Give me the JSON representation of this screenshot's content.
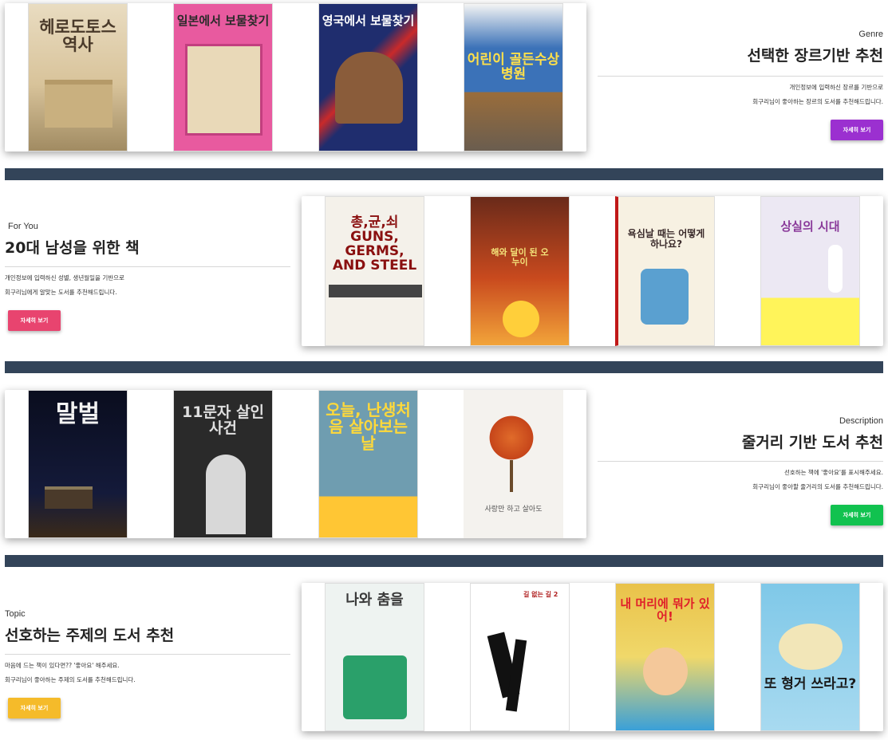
{
  "colors": {
    "divider": "#334459",
    "genre_button": "#9b30d0",
    "foryou_button": "#e8446f",
    "description_button": "#11c24f",
    "topic_button": "#f5bb2a"
  },
  "genre": {
    "tag": "Genre",
    "heading": "선택한 장르기반 추천",
    "desc_line1": "개인정보에 입력하신 장르를 기반으로",
    "desc_line2": "회구리님이 좋아하는 장르의 도서를 추천해드립니다.",
    "button": "자세히 보기",
    "books": [
      {
        "title": "헤로도토스 역사",
        "cover": "#d8c39a"
      },
      {
        "title": "일본에서 보물찾기",
        "cover": "#e85a9f"
      },
      {
        "title": "영국에서 보물찾기",
        "cover": "#1f2d6e"
      },
      {
        "title": "어린이 골든수상 병원",
        "cover": "#3b72b8"
      }
    ]
  },
  "foryou": {
    "tag": "For You",
    "heading": "20대 남성을 위한 책",
    "desc_line1": "개인정보에 입력하신 성별, 생년월일을 기반으로",
    "desc_line2": "회구리님에게 알맞는 도서를 추천해드립니다.",
    "button": "자세히 보기",
    "books": [
      {
        "title": "총,균,쇠 GUNS, GERMS, AND STEEL",
        "cover": "#f4f1ea"
      },
      {
        "title": "해와 달이 된 오누이",
        "cover": "#c94a1e"
      },
      {
        "title": "욕심날 때는 어떻게 하나요?",
        "cover": "#f7f1e2"
      },
      {
        "title": "상실의 시대",
        "cover": "#ece8f3"
      }
    ]
  },
  "description": {
    "tag": "Description",
    "heading": "줄거리 기반 도서 추천",
    "desc_line1": "선호하는 책에 '좋아요'를 표시해주세요.",
    "desc_line2": "회구리님이 좋아할 줄거리의 도서를 추천해드립니다.",
    "button": "자세히 보기",
    "books": [
      {
        "title": "말벌",
        "cover": "#0e1226"
      },
      {
        "title": "11문자 살인사건",
        "cover": "#2a2a2a"
      },
      {
        "title": "오늘, 난생처음 살아보는 날",
        "cover": "#6f9db0"
      },
      {
        "title": "사랑만 하고 살아도",
        "cover": "#f4f2ee"
      }
    ]
  },
  "topic": {
    "tag": "Topic",
    "heading": "선호하는 주제의 도서 추천",
    "desc_line1": "마음에 드는 책이 있다면?? '좋아요' 해주세요.",
    "desc_line2": "회구리님이 좋아하는 주제의 도서를 추천해드립니다.",
    "button": "자세히 보기",
    "books": [
      {
        "title": "나와 춤을",
        "cover": "#eef3f1"
      },
      {
        "title": "길 없는 길 2",
        "cover": "#ffffff"
      },
      {
        "title": "내 머리에 뭐가 있어!",
        "cover": "#e9c24a"
      },
      {
        "title": "또 형거 쓰라고?",
        "cover": "#7fc8e8"
      }
    ]
  }
}
